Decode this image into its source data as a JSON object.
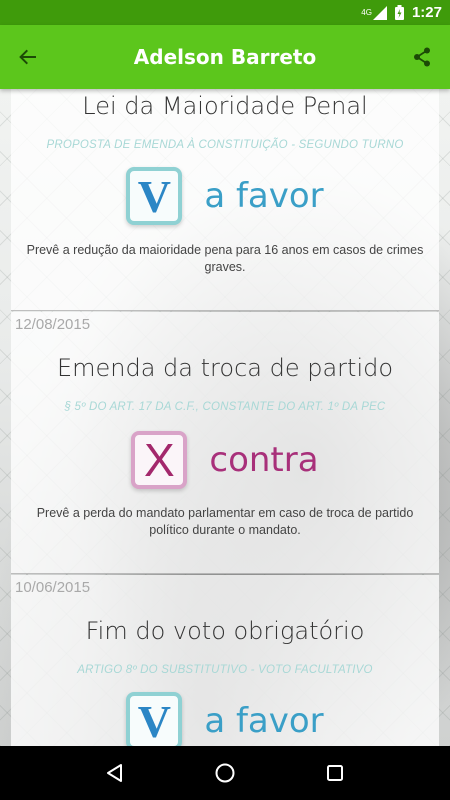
{
  "status_bar": {
    "network": "4G",
    "time": "1:27"
  },
  "app_bar": {
    "title": "Adelson Barreto",
    "back_icon": "arrow-back-icon",
    "share_icon": "share-icon"
  },
  "colors": {
    "status_bar": "#3f9b0b",
    "app_bar": "#5cc61c",
    "favor_accent": "#3a9fc7",
    "contra_accent": "#a8307a"
  },
  "votes": [
    {
      "date": "",
      "title": "Lei da Maioridade Penal",
      "subtitle": "PROPOSTA DE EMENDA À CONSTITUIÇÃO - SEGUNDO TURNO",
      "vote_letter": "V",
      "vote_text": "a favor",
      "description": "Prevê a redução da maioridade pena para 16 anos em casos de crimes graves."
    },
    {
      "date": "12/08/2015",
      "title": "Emenda da troca de partido",
      "subtitle": "§ 5º DO ART. 17 DA C.F., CONSTANTE DO ART. 1º DA PEC",
      "vote_letter": "X",
      "vote_text": "contra",
      "description": "Prevê a perda do mandato parlamentar em caso de troca de partido político durante o mandato."
    },
    {
      "date": "10/06/2015",
      "title": "Fim do voto obrigatório",
      "subtitle": "ARTIGO 8º DO SUBSTITUTIVO - VOTO FACULTATIVO",
      "vote_letter": "V",
      "vote_text": "a favor",
      "description": ""
    }
  ]
}
